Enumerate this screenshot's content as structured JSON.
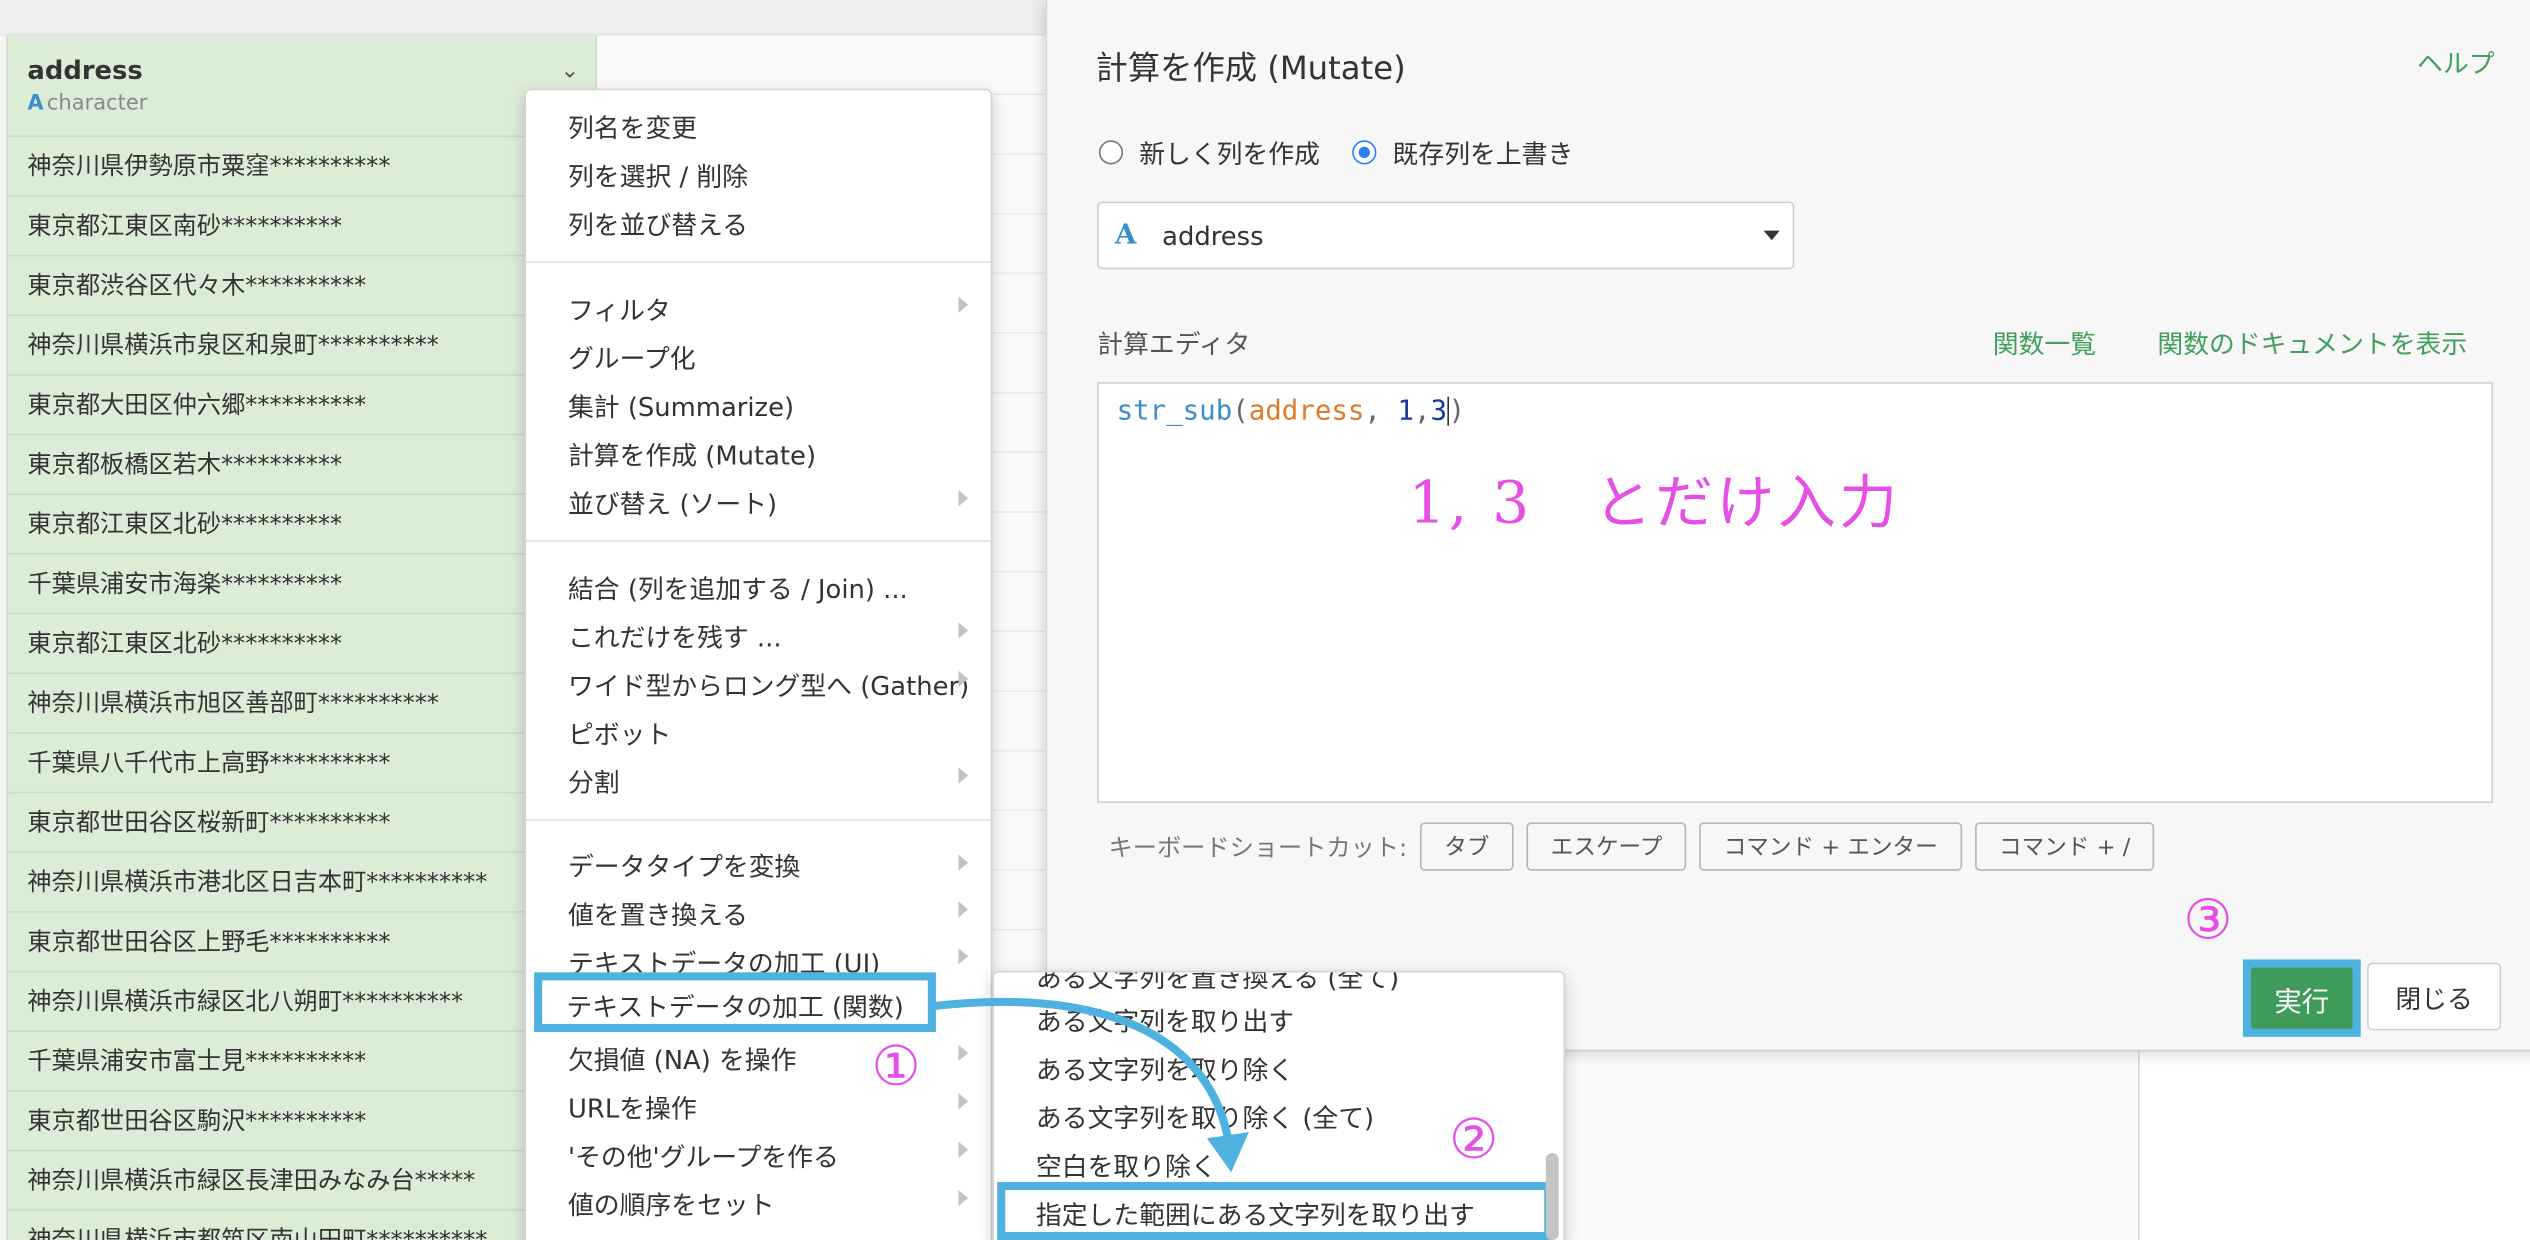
{
  "column": {
    "name": "address",
    "type_icon": "A",
    "type": "character",
    "rows": [
      "神奈川県伊勢原市粟窪**********",
      "東京都江東区南砂**********",
      "東京都渋谷区代々木**********",
      "神奈川県横浜市泉区和泉町**********",
      "東京都大田区仲六郷**********",
      "東京都板橋区若木**********",
      "東京都江東区北砂**********",
      "千葉県浦安市海楽**********",
      "東京都江東区北砂**********",
      "神奈川県横浜市旭区善部町**********",
      "千葉県八千代市上高野**********",
      "東京都世田谷区桜新町**********",
      "神奈川県横浜市港北区日吉本町**********",
      "東京都世田谷区上野毛**********",
      "神奈川県横浜市緑区北八朔町**********",
      "千葉県浦安市富士見**********",
      "東京都世田谷区駒沢**********",
      "神奈川県横浜市緑区長津田みなみ台*****",
      "神奈川県横浜市都筑区南山田町**********"
    ]
  },
  "menu": {
    "group1": [
      "列名を変更",
      "列を選択 / 削除",
      "列を並び替える"
    ],
    "group2": [
      "フィルタ",
      "グループ化",
      "集計 (Summarize)",
      "計算を作成 (Mutate)",
      "並び替え (ソート)"
    ],
    "group3": [
      "結合 (列を追加する / Join) ...",
      "これだけを残す ...",
      "ワイド型からロング型へ (Gather)",
      "ピボット",
      "分割"
    ],
    "group4": [
      "データタイプを変換",
      "値を置き換える",
      "テキストデータの加工 (UI)",
      "テキストデータの加工 (関数)",
      "欠損値 (NA) を操作",
      "URLを操作",
      "'その他'グループを作る",
      "値の順序をセット"
    ]
  },
  "submenu": {
    "items": [
      "ある文字列を置き換える (全て)",
      "ある文字列を取り出す",
      "ある文字列を取り除く",
      "ある文字列を取り除く (全て)",
      "空白を取り除く",
      "指定した範囲にある文字列を取り出す"
    ]
  },
  "dialog": {
    "title": "計算を作成 (Mutate)",
    "help": "ヘルプ",
    "radio_new": "新しく列を作成",
    "radio_overwrite": "既存列を上書き",
    "select_icon": "A",
    "select_value": "address",
    "editor_label": "計算エディタ",
    "link_functions": "関数一覧",
    "link_docs": "関数のドキュメントを表示",
    "code": {
      "fn": "str_sub",
      "open": "(",
      "arg": "address",
      "sep1": ", ",
      "n1": "1",
      "comma": ",",
      "n2": "3",
      "close": ")"
    },
    "annotation": "1, 3　とだけ入力",
    "shortcut_label": "キーボードショートカット:",
    "shortcuts": [
      "タブ",
      "エスケープ",
      "コマンド + エンター",
      "コマンド + /"
    ],
    "run": "実行",
    "close": "閉じる"
  },
  "annotations": {
    "step1": "①",
    "step2": "②",
    "step3": "③"
  },
  "colors": {
    "highlight": "#4fb1e0",
    "annotation": "#e54fe5",
    "accent": "#3f9b5a",
    "column_bg": "#dcedd7"
  }
}
